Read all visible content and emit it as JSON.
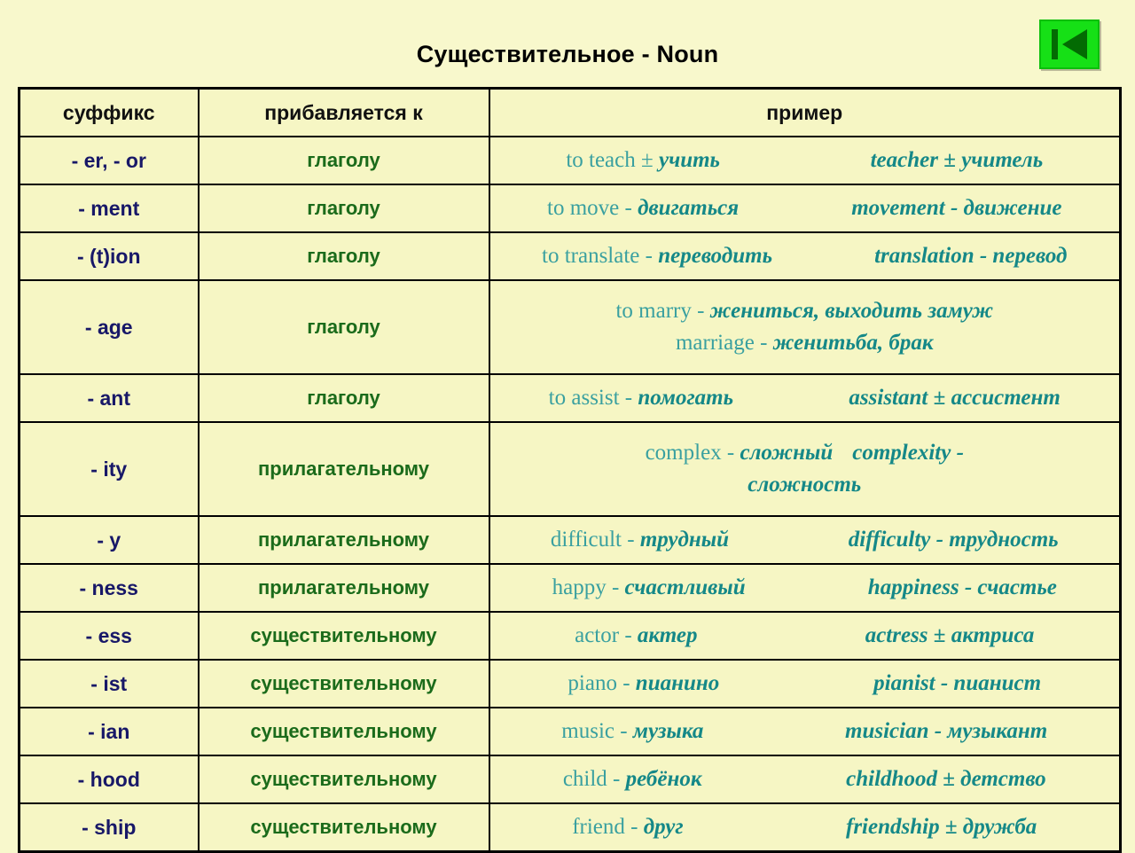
{
  "header": {
    "title": "Существительное - Noun",
    "nav_button": {
      "name": "previous-slide-button",
      "icon": "skip-back-icon",
      "color": "#16e016"
    }
  },
  "colors": {
    "background": "#f8f8cc",
    "cell_background": "#f6f6c4",
    "suffix_text": "#181868",
    "attach_text": "#1b6b1b",
    "example_english": "#3aa0a0",
    "example_russian": "#158888",
    "border": "#000000",
    "accent_green": "#16e016"
  },
  "table": {
    "columns": [
      "суффикс",
      "прибавляется к",
      "пример"
    ],
    "rows": [
      {
        "suffix": "- er, - or",
        "attach": "глаголу",
        "tall": false,
        "lines": [
          [
            {
              "eng": "to teach ",
              "sep": "±",
              "rus": " учить"
            },
            {
              "eng": "teacher ",
              "sep": "±",
              "rus": " учитель",
              "all_italic": true
            }
          ]
        ]
      },
      {
        "suffix": "- ment",
        "attach": "глаголу",
        "tall": false,
        "lines": [
          [
            {
              "eng": "to move ",
              "sep": "-",
              "rus": " двигаться"
            },
            {
              "eng": "movement ",
              "sep": "-",
              "rus": " движение",
              "all_italic": true
            }
          ]
        ]
      },
      {
        "suffix": "- (t)ion",
        "attach": "глаголу",
        "tall": false,
        "lines": [
          [
            {
              "eng": "to translate ",
              "sep": "-",
              "rus": " переводить"
            },
            {
              "eng": "translation ",
              "sep": "-",
              "rus": " перевод",
              "all_italic": true
            }
          ]
        ]
      },
      {
        "suffix": "- age",
        "attach": "глаголу",
        "tall": true,
        "lines": [
          [
            {
              "eng": "to marry ",
              "sep": "-",
              "rus": " жениться, выходить замуж",
              "center": true
            }
          ],
          [
            {
              "eng": "marriage ",
              "sep": "-",
              "rus": " женитьба, брак",
              "center": true
            }
          ]
        ]
      },
      {
        "suffix": "- ant",
        "attach": "глаголу",
        "tall": false,
        "lines": [
          [
            {
              "eng": "to assist ",
              "sep": "-",
              "rus": " помогать"
            },
            {
              "eng": "assistant ",
              "sep": "±",
              "rus": " ассистент",
              "all_italic": true
            }
          ]
        ]
      },
      {
        "suffix": "- ity",
        "attach": "прилагательному",
        "tall": true,
        "lines": [
          [
            {
              "eng": "complex ",
              "sep": "-",
              "rus": " сложный",
              "center": true
            },
            {
              "eng": "complexity ",
              "sep": "-",
              "rus": "",
              "all_italic": true,
              "center": true
            }
          ],
          [
            {
              "eng": "",
              "sep": "",
              "rus": "сложность",
              "center": true
            }
          ]
        ]
      },
      {
        "suffix": "- y",
        "attach": "прилагательному",
        "tall": false,
        "lines": [
          [
            {
              "eng": "difficult ",
              "sep": "-",
              "rus": " трудный"
            },
            {
              "eng": "difficulty ",
              "sep": "-",
              "rus": " трудность",
              "all_italic": true
            }
          ]
        ]
      },
      {
        "suffix": "- ness",
        "attach": "прилагательному",
        "tall": false,
        "lines": [
          [
            {
              "eng": "happy ",
              "sep": "-",
              "rus": " счастливый"
            },
            {
              "eng": "happiness ",
              "sep": "-",
              "rus": " счастье",
              "all_italic": true
            }
          ]
        ]
      },
      {
        "suffix": "- ess",
        "attach": "существительному",
        "tall": false,
        "lines": [
          [
            {
              "eng": "actor ",
              "sep": "-",
              "rus": " актер"
            },
            {
              "eng": "actress ",
              "sep": "±",
              "rus": " актриса",
              "all_italic": true
            }
          ]
        ]
      },
      {
        "suffix": "- ist",
        "attach": "существительному",
        "tall": false,
        "lines": [
          [
            {
              "eng": "piano ",
              "sep": "-",
              "rus": " пианино"
            },
            {
              "eng": "pianist ",
              "sep": "-",
              "rus": " пианист",
              "all_italic": true
            }
          ]
        ]
      },
      {
        "suffix": "- ian",
        "attach": "существительному",
        "tall": false,
        "lines": [
          [
            {
              "eng": "music ",
              "sep": "-",
              "rus": " музыка"
            },
            {
              "eng": "musician ",
              "sep": "-",
              "rus": " музыкант",
              "all_italic": true
            }
          ]
        ]
      },
      {
        "suffix": "- hood",
        "attach": "существительному",
        "tall": false,
        "lines": [
          [
            {
              "eng": "child ",
              "sep": "-",
              "rus": " ребёнок"
            },
            {
              "eng": "childhood ",
              "sep": "±",
              "rus": " детство",
              "all_italic": true
            }
          ]
        ]
      },
      {
        "suffix": "- ship",
        "attach": "существительному",
        "tall": false,
        "lines": [
          [
            {
              "eng": "friend ",
              "sep": "-",
              "rus": " друг"
            },
            {
              "eng": "friendship ",
              "sep": "±",
              "rus": " дружба",
              "all_italic": true
            }
          ]
        ]
      }
    ]
  }
}
